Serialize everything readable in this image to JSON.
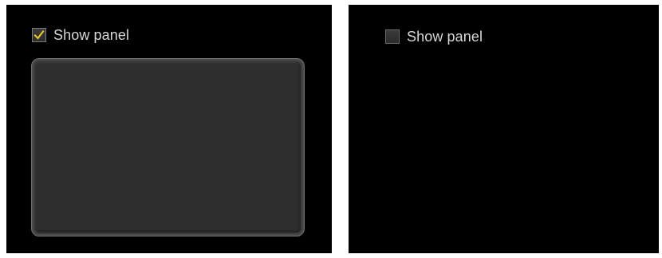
{
  "left_demo": {
    "checkbox": {
      "label": "Show panel",
      "checked": true,
      "check_color": "#e8c52a"
    },
    "panel_visible": true
  },
  "right_demo": {
    "checkbox": {
      "label": "Show panel",
      "checked": false
    },
    "panel_visible": false
  }
}
